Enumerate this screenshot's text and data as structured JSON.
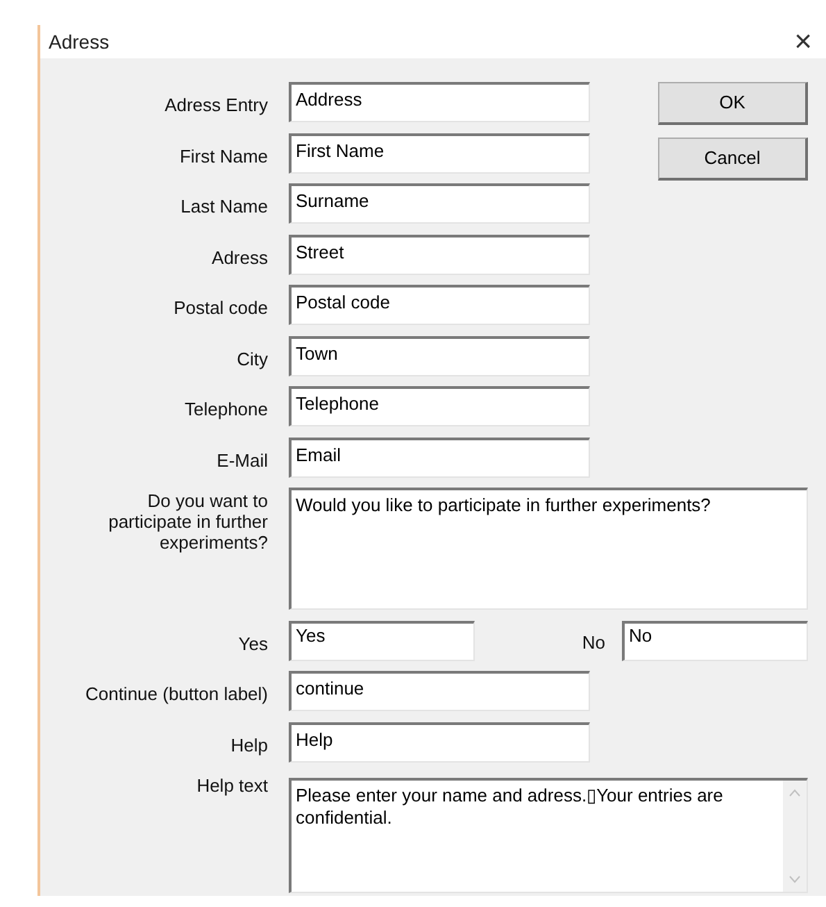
{
  "window": {
    "title": "Adress",
    "close": "×"
  },
  "fields": [
    {
      "kind": "single",
      "label": "Adress Entry",
      "value": "Address"
    },
    {
      "kind": "single",
      "label": "First Name",
      "value": "First Name"
    },
    {
      "kind": "single",
      "label": "Last Name",
      "value": "Surname"
    },
    {
      "kind": "single",
      "label": "Adress",
      "value": "Street"
    },
    {
      "kind": "single",
      "label": "Postal code",
      "value": "Postal code"
    },
    {
      "kind": "single",
      "label": "City",
      "value": "Town"
    },
    {
      "kind": "single",
      "label": "Telephone",
      "value": "Telephone"
    },
    {
      "kind": "single",
      "label": "E-Mail",
      "value": "Email"
    },
    {
      "kind": "multiline",
      "label": "Do you want to participate in further experiments?",
      "value": "Would you like to participate in further experiments?"
    },
    {
      "kind": "pair",
      "label": "Yes",
      "value": "Yes",
      "label_2": "No",
      "value_2": "No"
    },
    {
      "kind": "single",
      "label": "Continue (button label)",
      "value": "continue"
    },
    {
      "kind": "single",
      "label": "Help",
      "value": "Help"
    },
    {
      "kind": "scroll",
      "label": "Help text",
      "value": "Please enter your name and adress.▯Your entries are confidential."
    }
  ],
  "buttons": [
    "OK",
    "Cancel"
  ]
}
